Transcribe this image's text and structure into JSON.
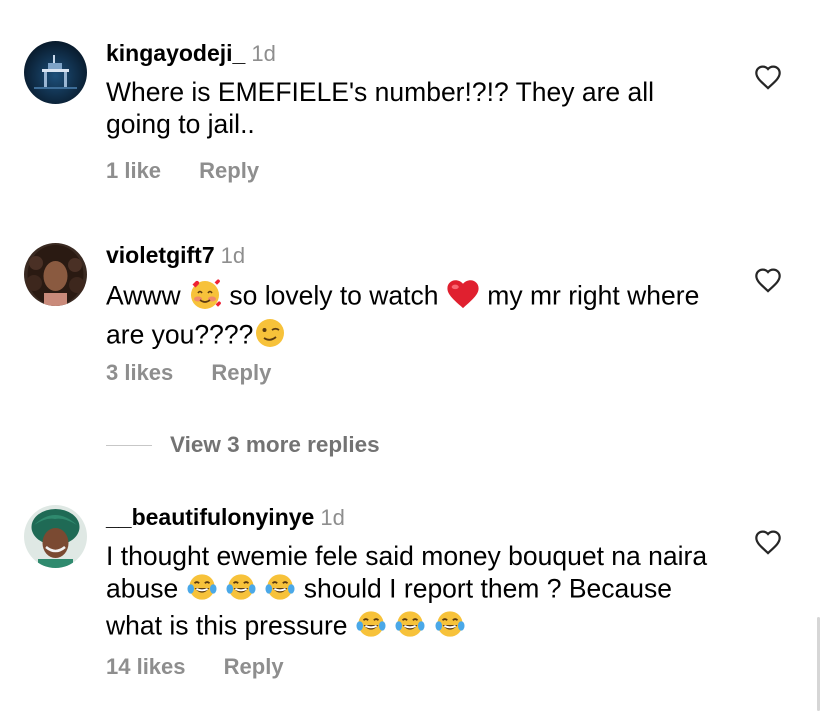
{
  "comments": [
    {
      "username": "kingayodeji_",
      "time": "1d",
      "text": "Where is EMEFIELE's number!?!? They are all going to jail..",
      "likes": "1 like",
      "reply": "Reply"
    },
    {
      "username": "violetgift7",
      "time": "1d",
      "text_parts": [
        "Awww",
        "so lovely to watch",
        "my mr right where are you????"
      ],
      "likes": "3 likes",
      "reply": "Reply"
    },
    {
      "username": "__beautifulonyinye",
      "time": "1d",
      "text_parts": [
        "I thought ewemie fele said money bouquet na naira abuse",
        "should I report them ? Because what is this pressure"
      ],
      "likes": "14 likes",
      "reply": "Reply"
    }
  ],
  "view_more": "View 3 more replies",
  "icons": [
    "heart-outline-icon",
    "smiling-face-with-hearts-emoji",
    "red-heart-emoji",
    "winking-face-emoji",
    "face-with-tears-of-joy-emoji"
  ],
  "colors": {
    "secondary_text": "#8e8e8e",
    "divider": "#c7c7c7"
  }
}
